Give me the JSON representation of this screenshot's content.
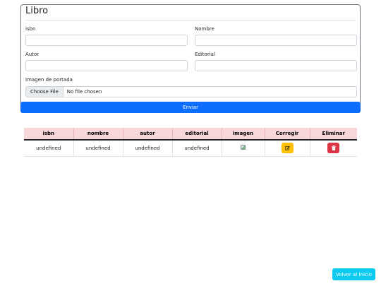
{
  "form": {
    "title": "Libro",
    "fields": {
      "isbn": {
        "label": "isbn",
        "value": ""
      },
      "nombre": {
        "label": "Nombre",
        "value": ""
      },
      "autor": {
        "label": "Autor",
        "value": ""
      },
      "editorial": {
        "label": "Editorial",
        "value": ""
      }
    },
    "cover": {
      "label": "Imagen de portada",
      "button_label": "Choose File",
      "status": "No file chosen"
    },
    "submit_label": "Enviar"
  },
  "table": {
    "headers": [
      "isbn",
      "nombre",
      "autor",
      "editorial",
      "imagen",
      "Corregir",
      "Eliminar"
    ],
    "rows": [
      {
        "isbn": "undefined",
        "nombre": "undefined",
        "autor": "undefined",
        "editorial": "undefined",
        "imagen": "broken-image-icon",
        "corregir": "edit-icon",
        "eliminar": "trash-icon"
      }
    ]
  },
  "colors": {
    "primary": "#0d6efd",
    "info": "#0dcaf0",
    "warning": "#ffc107",
    "danger": "#dc3545",
    "table_header": "#f8d7da"
  },
  "footer": {
    "back_label": "Volver al Inicio"
  }
}
